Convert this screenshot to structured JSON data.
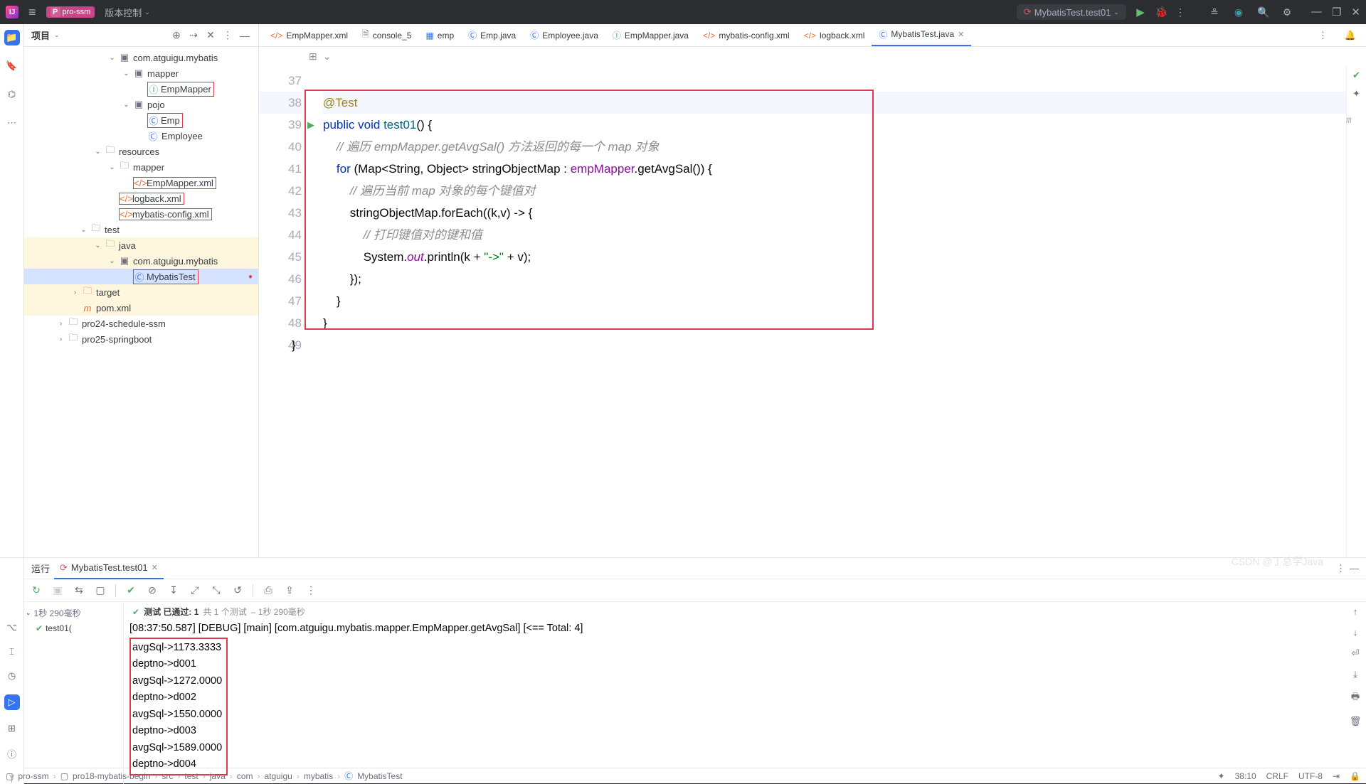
{
  "titlebar": {
    "project": "pro-ssm",
    "vcs": "版本控制",
    "run_config": "MybatisTest.test01"
  },
  "proj_panel": {
    "title": "项目"
  },
  "tree": {
    "n0": "com.atguigu.mybatis",
    "n1": "mapper",
    "n2": "EmpMapper",
    "n3": "pojo",
    "n4": "Emp",
    "n5": "Employee",
    "n6": "resources",
    "n7": "mapper",
    "n8": "EmpMapper.xml",
    "n9": "logback.xml",
    "n10": "mybatis-config.xml",
    "n11": "test",
    "n12": "java",
    "n13": "com.atguigu.mybatis",
    "n14": "MybatisTest",
    "n15": "target",
    "n16": "pom.xml",
    "n17": "pro24-schedule-ssm",
    "n18": "pro25-springboot"
  },
  "tabs": {
    "t0": "EmpMapper.xml",
    "t1": "console_5",
    "t2": "emp",
    "t3": "Emp.java",
    "t4": "Employee.java",
    "t5": "EmpMapper.java",
    "t6": "mybatis-config.xml",
    "t7": "logback.xml",
    "t8": "MybatisTest.java"
  },
  "gutter": {
    "l37": "37",
    "l38": "38",
    "l39": "39",
    "l40": "40",
    "l41": "41",
    "l42": "42",
    "l43": "43",
    "l44": "44",
    "l45": "45",
    "l46": "46",
    "l47": "47",
    "l48": "48",
    "l49": "49"
  },
  "code": {
    "c38_ann": "@Test",
    "c39_pub": "public ",
    "c39_void": "void ",
    "c39_fn": "test01",
    "c39_tail": "() {",
    "c40_cmt": "// 遍历 empMapper.getAvgSal() 方法返回的每一个 map 对象",
    "c41_for": "for ",
    "c41_body1": "(Map<String, Object> stringObjectMap : ",
    "c41_fld": "empMapper",
    "c41_body2": ".getAvgSal()) {",
    "c42_cmt": "// 遍历当前 map 对象的每个键值对",
    "c43": "stringObjectMap.forEach((k,v) -> {",
    "c44_cmt": "// 打印键值对的键和值",
    "c45_a": "System.",
    "c45_out": "out",
    "c45_b": ".println(k + ",
    "c45_s": "\"->\"",
    "c45_c": " + v);",
    "c46": "});",
    "c47": "}",
    "c48": "}",
    "c49": "}"
  },
  "run": {
    "tab_title": "运行",
    "tab_name": "MybatisTest.test01",
    "summary_time": "1秒 290毫秒",
    "summary_pass_label": "测试 已通过: 1",
    "summary_total": "共 1 个测试",
    "summary_dur": "– 1秒 290毫秒",
    "test_node": "test01(",
    "log_line": "[08:37:50.587] [DEBUG] [main] [com.atguigu.mybatis.mapper.EmpMapper.getAvgSal] [<==      Total: 4]",
    "o1": "avgSql->1173.3333",
    "o2": "deptno->d001",
    "o3": "avgSql->1272.0000",
    "o4": "deptno->d002",
    "o5": "avgSql->1550.0000",
    "o6": "deptno->d003",
    "o7": "avgSql->1589.0000",
    "o8": "deptno->d004"
  },
  "breadcrumb": {
    "b0": "pro-ssm",
    "b1": "pro18-mybatis-begin",
    "b2": "src",
    "b3": "test",
    "b4": "java",
    "b5": "com",
    "b6": "atguigu",
    "b7": "mybatis",
    "b8": "MybatisTest",
    "pos": "38:10",
    "enc": "CRLF",
    "cs": "UTF-8"
  },
  "watermark": "CSDN @丁总学Java"
}
